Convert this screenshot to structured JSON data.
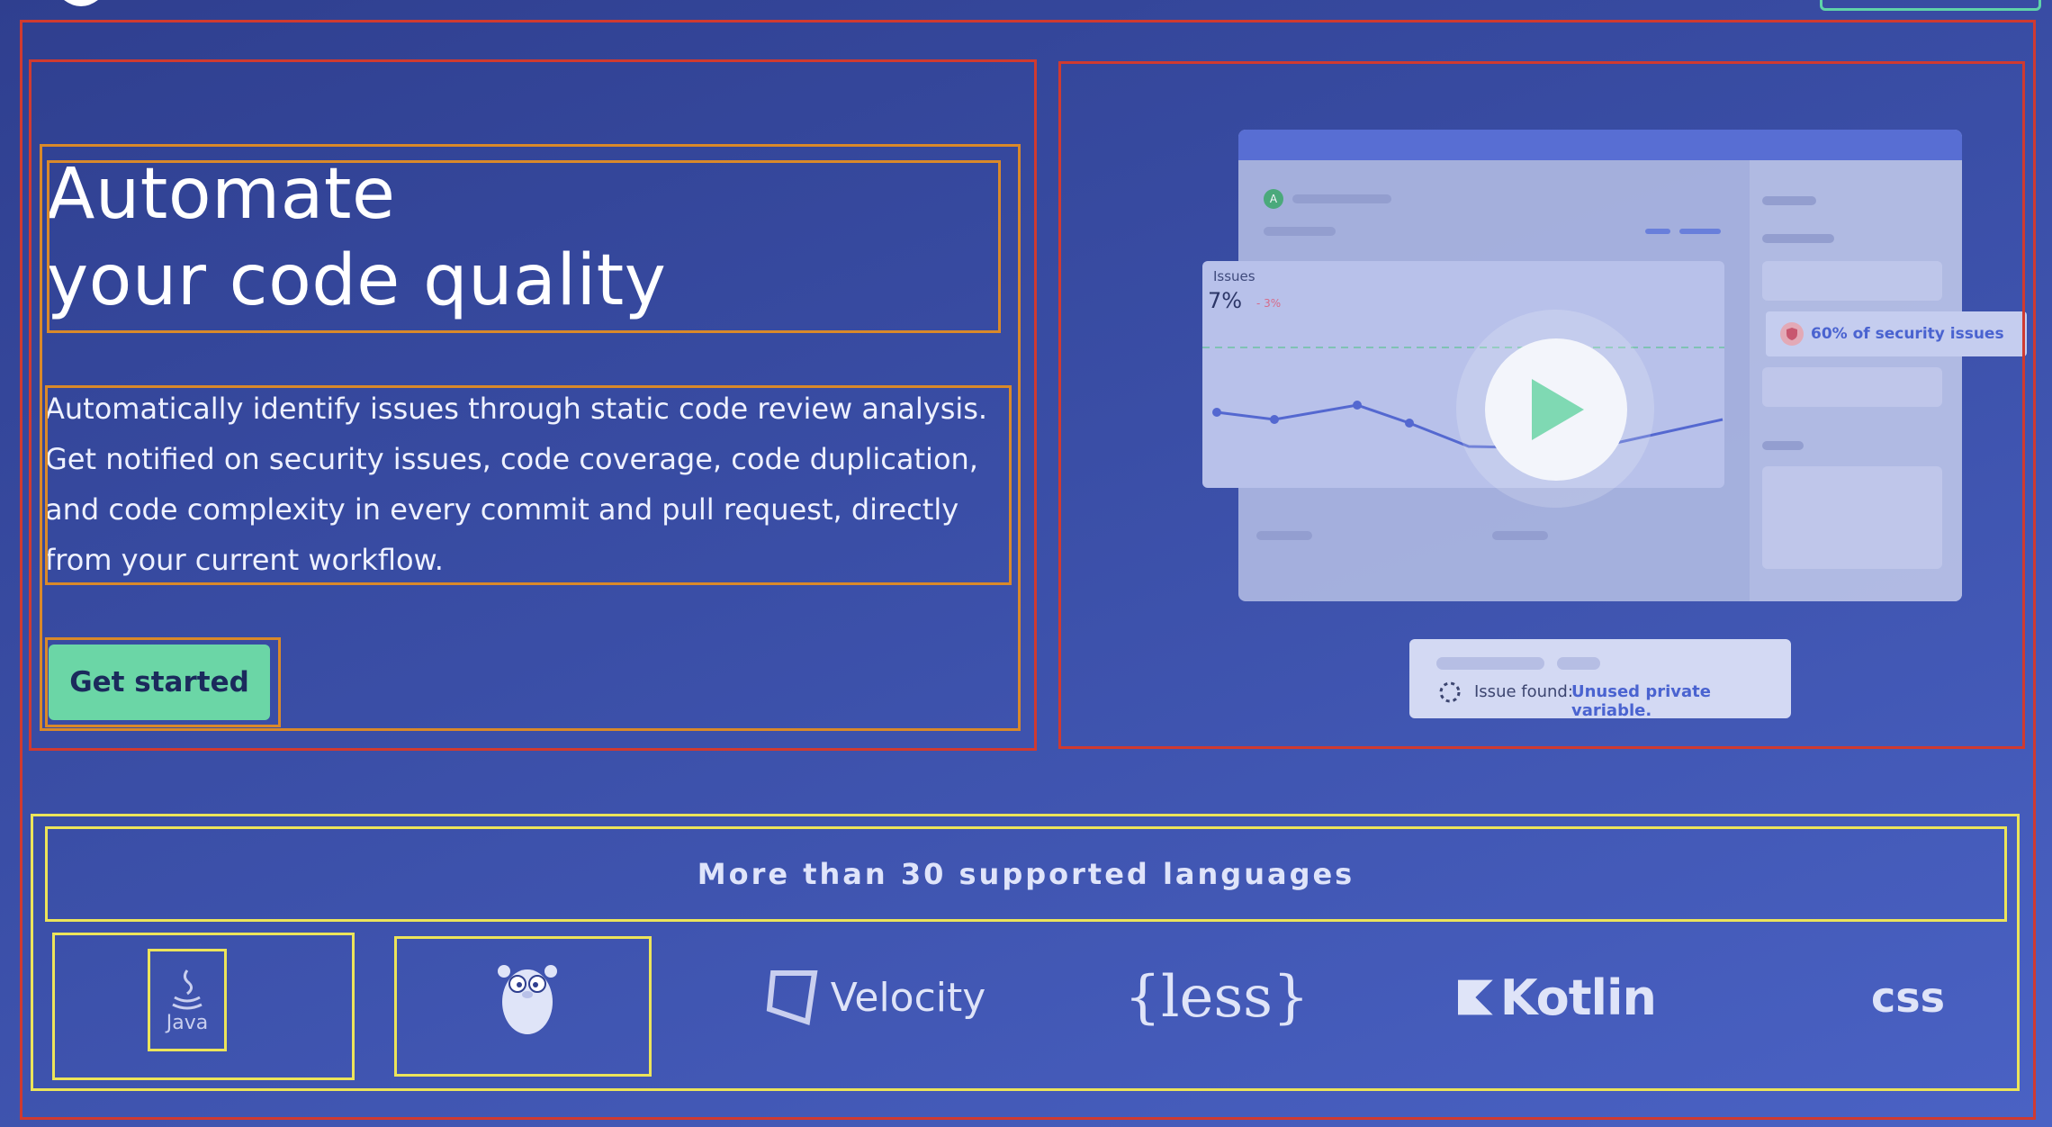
{
  "hero": {
    "title_line1": "Automate",
    "title_line2": "your code quality",
    "description": "Automatically identify issues through static code review analysis. Get notified on security issues, code coverage, code duplication, and code complexity in every commit and pull request, directly from your current workflow.",
    "cta_label": "Get started"
  },
  "mockup": {
    "issues_label": "Issues",
    "issues_value": "7%",
    "issues_delta": "- 3%",
    "security_note": "60% of security issues",
    "issue_found_label": "Issue found:",
    "issue_found_value": "Unused private variable."
  },
  "languages": {
    "title": "More than 30 supported languages",
    "logos": [
      {
        "name": "java",
        "text": "Java"
      },
      {
        "name": "go",
        "text": ""
      },
      {
        "name": "velocity",
        "text": "Velocity"
      },
      {
        "name": "less",
        "text": "{less}"
      },
      {
        "name": "kotlin",
        "text": "Kotlin"
      },
      {
        "name": "css",
        "text": "css"
      }
    ]
  },
  "colors": {
    "accent": "#6bd6a6",
    "background": "#3a4ea6",
    "link": "#4a63d0"
  }
}
